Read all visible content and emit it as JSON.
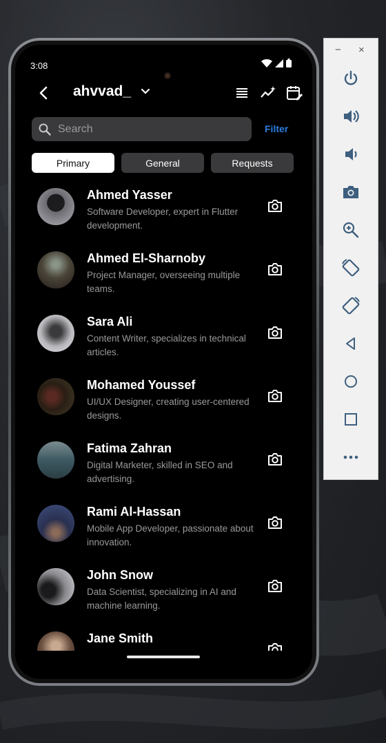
{
  "status": {
    "time": "3:08"
  },
  "appbar": {
    "account_name": "ahvvad_"
  },
  "search": {
    "placeholder": "Search"
  },
  "filter_label": "Filter",
  "tabs": [
    {
      "label": "Primary"
    },
    {
      "label": "General"
    },
    {
      "label": "Requests"
    }
  ],
  "contacts": [
    {
      "name": "Ahmed Yasser",
      "desc": "Software Developer, expert in Flutter development."
    },
    {
      "name": "Ahmed El-Sharnoby",
      "desc": "Project Manager, overseeing multiple teams."
    },
    {
      "name": "Sara Ali",
      "desc": "Content Writer, specializes in technical articles."
    },
    {
      "name": "Mohamed Youssef",
      "desc": "UI/UX Designer, creating user-centered designs."
    },
    {
      "name": "Fatima Zahran",
      "desc": "Digital Marketer, skilled in SEO and advertising."
    },
    {
      "name": "Rami Al-Hassan",
      "desc": "Mobile App Developer, passionate about innovation."
    },
    {
      "name": "John Snow",
      "desc": "Data Scientist, specializing in AI and machine learning."
    },
    {
      "name": "Jane Smith",
      "desc": ""
    }
  ],
  "side_panel": {
    "minimize": "−",
    "close": "×",
    "tools": [
      "power-icon",
      "volume-up-icon",
      "volume-down-icon",
      "screenshot-camera-icon",
      "zoom-in-icon",
      "rotate-left-icon",
      "rotate-right-icon",
      "back-triangle-icon",
      "home-circle-icon",
      "overview-square-icon",
      "more-dots-icon"
    ]
  },
  "colors": {
    "accent": "#2a7de1",
    "panel_icon": "#3e5f7e",
    "screen_bg": "#000000"
  }
}
